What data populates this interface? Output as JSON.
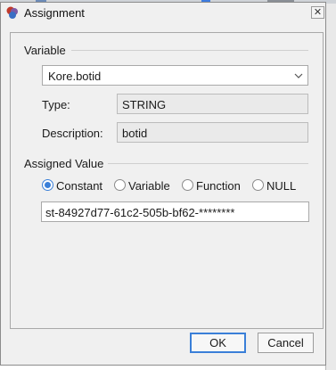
{
  "window": {
    "title": "Assignment",
    "close_glyph": "✕"
  },
  "variable_section": {
    "heading": "Variable",
    "selected": "Kore.botid",
    "type_label": "Type:",
    "type_value": "STRING",
    "description_label": "Description:",
    "description_value": "botid"
  },
  "assigned_section": {
    "heading": "Assigned Value",
    "options": [
      "Constant",
      "Variable",
      "Function",
      "NULL"
    ],
    "selected_option": "Constant",
    "value": "st-84927d77-61c2-505b-bf62-********"
  },
  "buttons": {
    "ok": "OK",
    "cancel": "Cancel"
  },
  "colors": {
    "accent": "#3a7fd8",
    "dialog_bg": "#f0f0f0",
    "border": "#a8a8a8"
  },
  "icons": {
    "app": "app-icon",
    "close": "close-icon",
    "combo_arrow": "chevron-down-icon"
  }
}
